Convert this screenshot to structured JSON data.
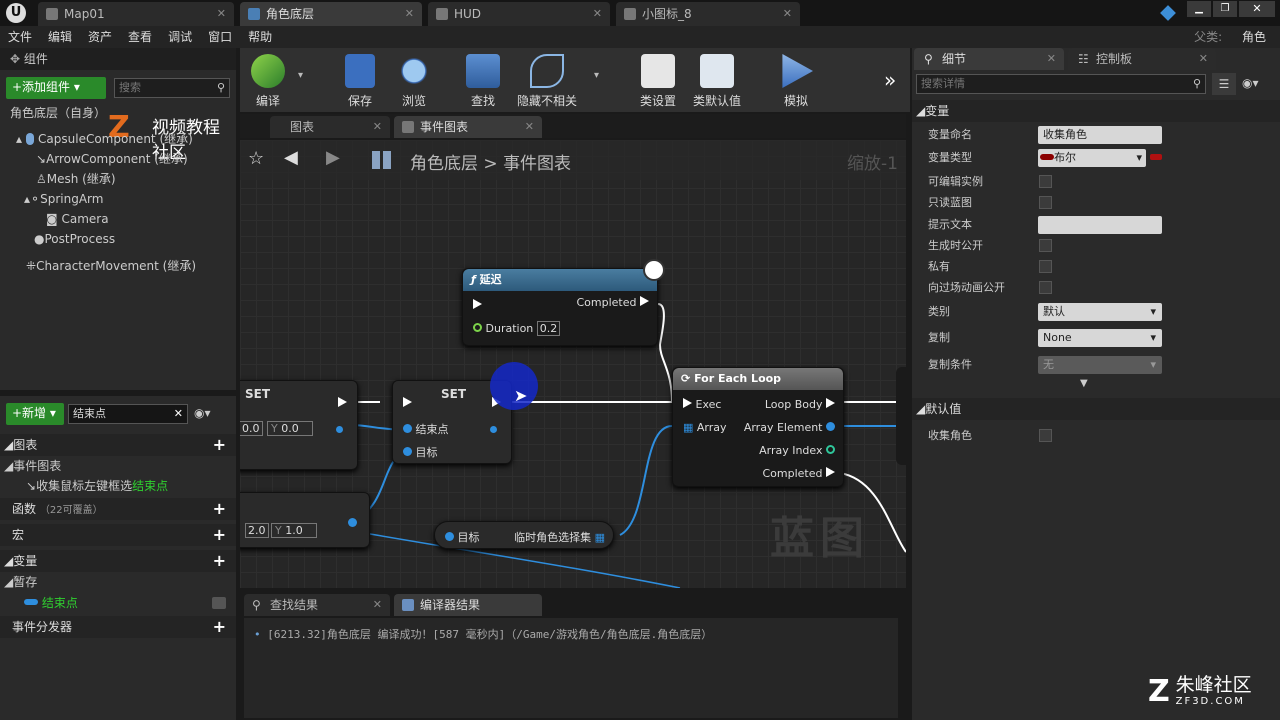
{
  "tabs": [
    {
      "label": "Map01"
    },
    {
      "label": "角色底层"
    },
    {
      "label": "HUD"
    },
    {
      "label": "小图标_8"
    }
  ],
  "parent_class": {
    "label": "父类:",
    "value": "角色"
  },
  "menu": [
    "文件",
    "编辑",
    "资产",
    "查看",
    "调试",
    "窗口",
    "帮助"
  ],
  "components": {
    "title": "组件",
    "add_label": "+添加组件",
    "search_placeholder": "搜索",
    "self_label": "角色底层（自身）",
    "watermark": "视频教程社区",
    "items": [
      {
        "label": "CapsuleComponent (继承)"
      },
      {
        "label": "ArrowComponent (继承)"
      },
      {
        "label": "Mesh (继承)"
      },
      {
        "label": "SpringArm"
      },
      {
        "label": "Camera"
      },
      {
        "label": "PostProcess"
      },
      {
        "label": "CharacterMovement (继承)"
      }
    ]
  },
  "my_blueprint": {
    "new_label": "+新增",
    "search_value": "结束点",
    "graphs": "图表",
    "event_graph": "事件图表",
    "event_item_prefix": "收集鼠标左键框选",
    "event_item_highlight": "结束点",
    "functions": "函数",
    "functions_note": "（22可覆盖）",
    "macros": "宏",
    "variables": "变量",
    "temp": "暂存",
    "var_item": "结束点",
    "dispatchers": "事件分发器"
  },
  "toolbar": [
    {
      "label": "编译",
      "icon": "compile-icon"
    },
    {
      "label": "保存",
      "icon": "save-icon"
    },
    {
      "label": "浏览",
      "icon": "browse-icon"
    },
    {
      "label": "查找",
      "icon": "find-icon"
    },
    {
      "label": "隐藏不相关",
      "icon": "hide-unrelated-icon"
    },
    {
      "label": "类设置",
      "icon": "class-settings-icon"
    },
    {
      "label": "类默认值",
      "icon": "class-defaults-icon"
    },
    {
      "label": "模拟",
      "icon": "simulate-icon"
    }
  ],
  "graph_tabs": [
    "图表",
    "事件图表"
  ],
  "breadcrumb": {
    "root": "角色底层",
    "sep": ">",
    "current": "事件图表",
    "zoom": "缩放-1"
  },
  "graph_watermark": "蓝图",
  "nodes": {
    "delay": {
      "title": "延迟",
      "completed": "Completed",
      "duration_label": "Duration",
      "duration_value": "0.2"
    },
    "set1": {
      "title": "SET",
      "x_value": "0.0",
      "y_label": "Y",
      "y_value": "0.0"
    },
    "set2": {
      "title": "SET",
      "pin1": "结束点",
      "pin2": "目标"
    },
    "foreach": {
      "title": "For Each Loop",
      "exec": "Exec",
      "array": "Array",
      "loop_body": "Loop Body",
      "array_element": "Array Element",
      "array_index": "Array Index",
      "completed": "Completed"
    },
    "vec": {
      "x_value": "2.0",
      "y_label": "Y",
      "y_value": "1.0"
    },
    "getter": {
      "target": "目标",
      "label": "临时角色选择集"
    }
  },
  "bottom_tabs": [
    "查找结果",
    "编译器结果"
  ],
  "log": "[6213.32]角色底层 编译成功！[587 毫秒内]（/Game/游戏角色/角色底层.角色底层）",
  "details": {
    "tab1": "细节",
    "tab2": "控制板",
    "search_placeholder": "搜索详情",
    "section_var": "变量",
    "rows": {
      "name_label": "变量命名",
      "name_value": "收集角色",
      "type_label": "变量类型",
      "type_value": "布尔",
      "editable": "可编辑实例",
      "readonly": "只读蓝图",
      "tooltip": "提示文本",
      "expose_spawn": "生成时公开",
      "private": "私有",
      "expose_cine": "向过场动画公开",
      "category_label": "类别",
      "category_value": "默认",
      "replication_label": "复制",
      "replication_value": "None",
      "rep_cond_label": "复制条件",
      "rep_cond_value": "无"
    },
    "section_default": "默认值",
    "default_label": "收集角色"
  },
  "brand": {
    "name": "朱峰社区",
    "url": "ZF3D.COM"
  },
  "colors": {
    "exec_white": "#ffffff",
    "vector_blue": "#2e8ede",
    "bool_red": "#8b0000",
    "add_green": "#2a8a2a"
  }
}
